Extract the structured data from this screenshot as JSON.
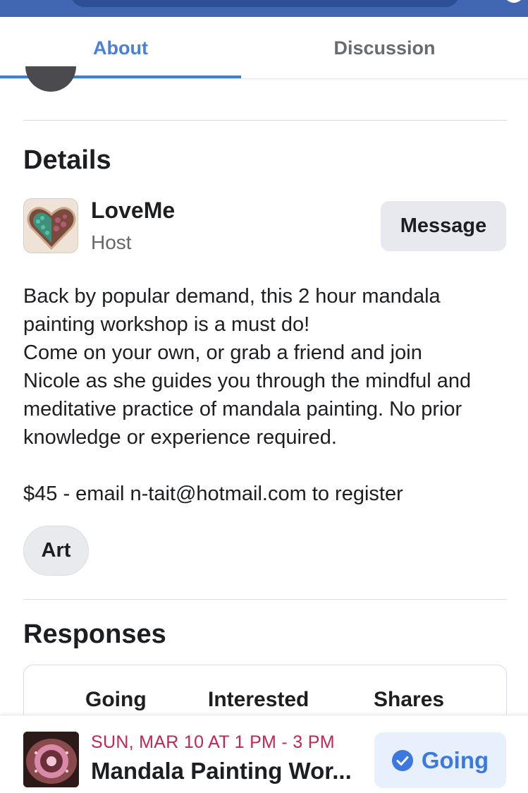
{
  "tabs": [
    {
      "label": "About",
      "active": true
    },
    {
      "label": "Discussion",
      "active": false
    }
  ],
  "details": {
    "title": "Details",
    "host_name": "LoveMe",
    "host_role": "Host",
    "message_label": "Message",
    "description_lines": [
      "Back by popular demand, this 2 hour mandala",
      "painting workshop is a must do!",
      "Come on your own, or grab a friend and join",
      "Nicole as she guides you through the mindful and",
      "meditative practice of mandala painting. No prior",
      "knowledge or experience required."
    ],
    "price_line": "$45 - email n-tait@hotmail.com to register",
    "category": "Art"
  },
  "responses": {
    "title": "Responses",
    "columns": [
      "Going",
      "Interested",
      "Shares"
    ]
  },
  "event_bar": {
    "date": "SUN, MAR 10 AT 1 PM - 3 PM",
    "title": "Mandala Painting Wor...",
    "going_label": "Going"
  },
  "colors": {
    "accent": "#3b79df",
    "date_red": "#c42654",
    "header_blue": "#4267b2"
  },
  "icons": {
    "chat": "messenger-icon",
    "going": "check-circle-icon"
  }
}
